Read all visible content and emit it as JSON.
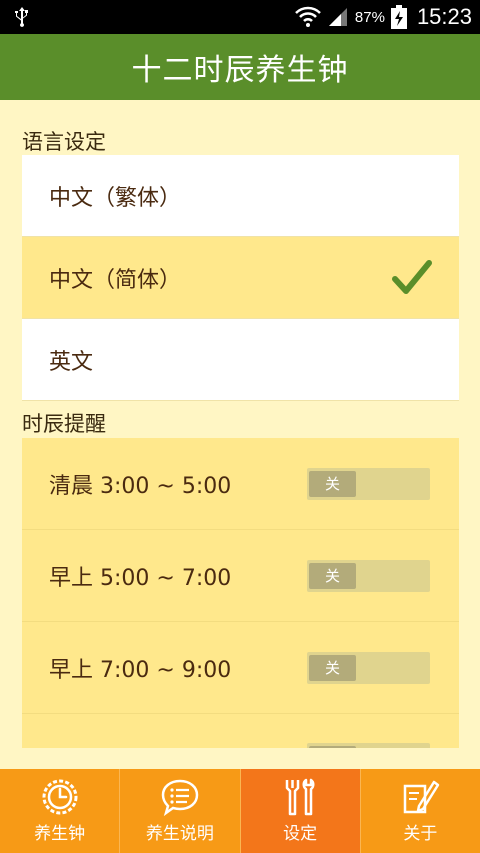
{
  "status_bar": {
    "battery_percent": "87%",
    "time": "15:23"
  },
  "app_bar": {
    "title": "十二时辰养生钟"
  },
  "language_section": {
    "header": "语言设定",
    "items": [
      {
        "label": "中文（繁体）",
        "selected": false
      },
      {
        "label": "中文（简体）",
        "selected": true
      },
      {
        "label": "英文",
        "selected": false
      }
    ]
  },
  "reminder_section": {
    "header": "时辰提醒",
    "items": [
      {
        "label": "清晨 3:00 ~ 5:00",
        "toggle_text": "关"
      },
      {
        "label": "早上 5:00 ~ 7:00",
        "toggle_text": "关"
      },
      {
        "label": "早上 7:00 ~ 9:00",
        "toggle_text": "关"
      }
    ]
  },
  "tabs": [
    {
      "label": "养生钟",
      "icon": "clock-gear-icon",
      "active": false
    },
    {
      "label": "养生说明",
      "icon": "chat-list-icon",
      "active": false
    },
    {
      "label": "设定",
      "icon": "tools-icon",
      "active": true
    },
    {
      "label": "关于",
      "icon": "note-pen-icon",
      "active": false
    }
  ],
  "colors": {
    "app_bar": "#5a8e2a",
    "background": "#fff6c4",
    "selected_row": "#ffe88c",
    "tab_bar": "#f79a16",
    "tab_active": "#f3761a",
    "check": "#5a8e2a"
  }
}
